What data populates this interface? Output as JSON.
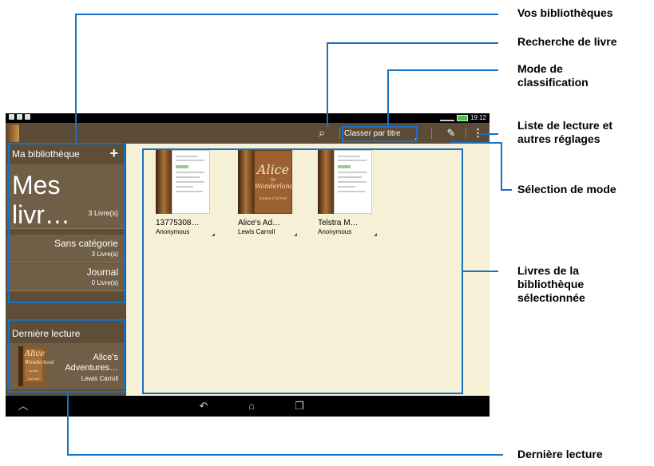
{
  "status_bar": {
    "time": "19:12"
  },
  "action_bar": {
    "sort_mode": "Classer par titre",
    "icons": [
      "search-icon",
      "pencil-icon",
      "overflow-menu-icon"
    ]
  },
  "sidebar": {
    "header": "Ma bibliothèque",
    "add_symbol": "+",
    "main_library": {
      "name": "Mes livr…",
      "count": "3 Livre(s)"
    },
    "categories": [
      {
        "name": "Sans catégorie",
        "count": "3 Livre(s)"
      },
      {
        "name": "Journal",
        "count": "0 Livre(s)"
      }
    ],
    "recent_title": "Dernière lecture",
    "recent_book": {
      "line1": "Alice's",
      "line2": "Adventures…",
      "author": "Lewis Carroll",
      "cover_title": "Alice",
      "cover_sub": "in",
      "cover_word": "Wonderland",
      "cover_author": "Lewis Carroll"
    }
  },
  "books": [
    {
      "title": "13775308…",
      "author": "Anonymous"
    },
    {
      "title": "Alice's Ad…",
      "author": "Lewis Carroll",
      "cover_title": "Alice",
      "cover_sub": "in",
      "cover_word": "Wonderland",
      "cover_author": "Lewis Carroll"
    },
    {
      "title": "Telstra M…",
      "author": "Anonymous"
    }
  ],
  "callouts": {
    "libraries": "Vos bibliothèques",
    "search": "Recherche de livre",
    "sort_1": "Mode de",
    "sort_2": "classification",
    "reading_1": "Liste de lecture et",
    "reading_2": "autres réglages",
    "mode": "Sélection de mode",
    "books_1": "Livres de la",
    "books_2": "bibliothèque",
    "books_3": "sélectionnée",
    "last": "Dernière lecture"
  },
  "colors": {
    "accent": "#1672c4",
    "action_bar": "#5b4b37",
    "shelf": "#f6f0d6"
  }
}
